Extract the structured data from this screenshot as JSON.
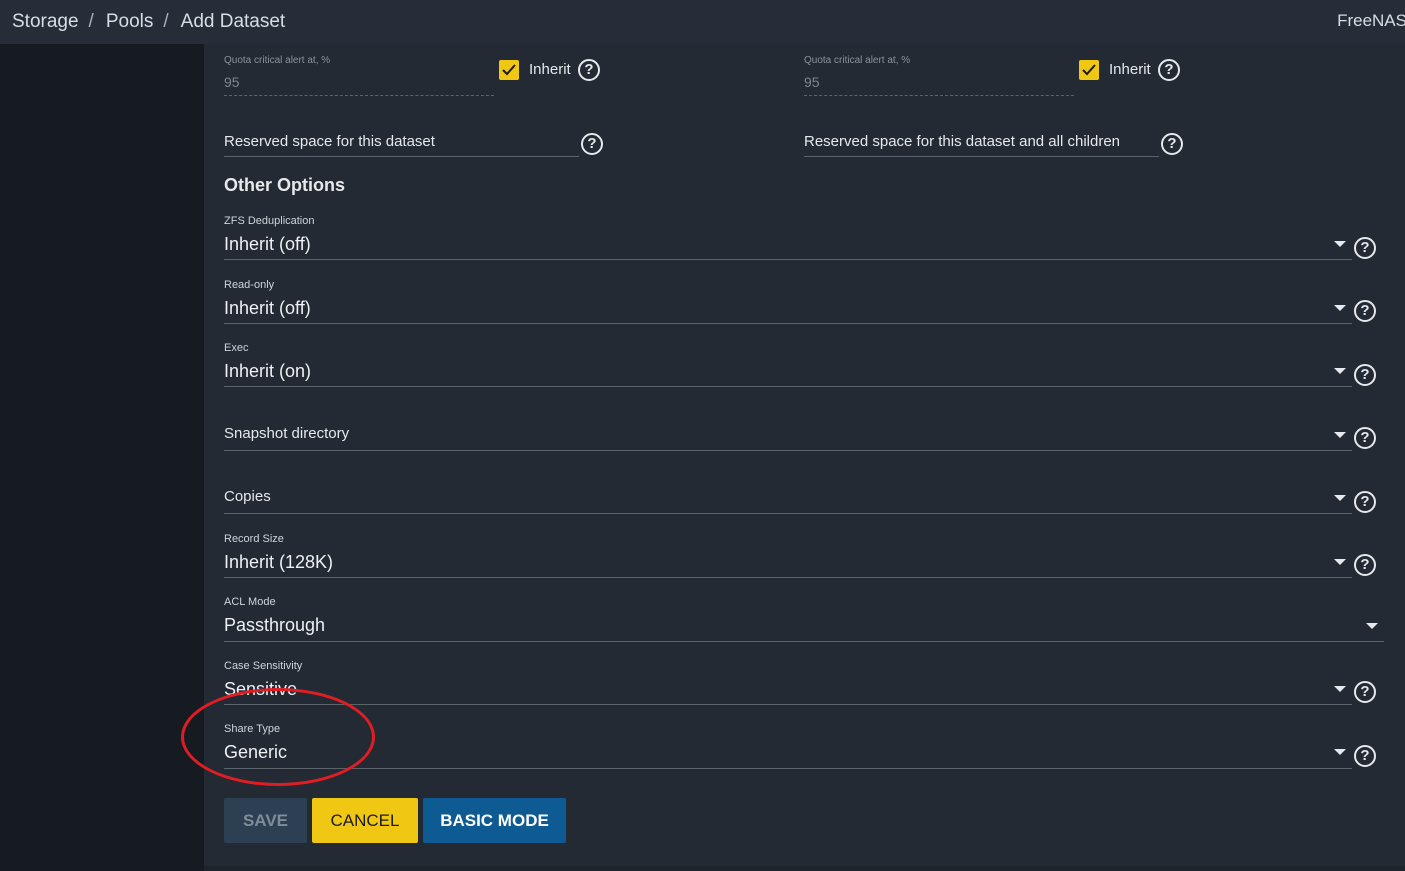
{
  "breadcrumb": [
    "Storage",
    "Pools",
    "Add Dataset"
  ],
  "brand": "FreeNAS",
  "quota_left": {
    "label": "Quota critical alert at, %",
    "value": "95",
    "inherit_label": "Inherit"
  },
  "quota_right": {
    "label": "Quota critical alert at, %",
    "value": "95",
    "inherit_label": "Inherit"
  },
  "reserved_left": {
    "placeholder": "Reserved space for this dataset"
  },
  "reserved_right": {
    "placeholder": "Reserved space for this dataset and all children"
  },
  "section_title": "Other Options",
  "fields": {
    "dedup": {
      "label": "ZFS Deduplication",
      "value": "Inherit (off)"
    },
    "readonly": {
      "label": "Read-only",
      "value": "Inherit (off)"
    },
    "exec": {
      "label": "Exec",
      "value": "Inherit (on)"
    },
    "snapdir": {
      "placeholder": "Snapshot directory"
    },
    "copies": {
      "placeholder": "Copies"
    },
    "recordsize": {
      "label": "Record Size",
      "value": "Inherit (128K)"
    },
    "aclmode": {
      "label": "ACL Mode",
      "value": "Passthrough"
    },
    "casesens": {
      "label": "Case Sensitivity",
      "value": "Sensitive"
    },
    "sharetype": {
      "label": "Share Type",
      "value": "Generic"
    }
  },
  "buttons": {
    "save": "SAVE",
    "cancel": "CANCEL",
    "basic": "BASIC MODE"
  },
  "help_glyph": "?",
  "colors": {
    "accent_yellow": "#f0c814",
    "primary_blue": "#0e5a93",
    "annotation_red": "#e11d24"
  }
}
